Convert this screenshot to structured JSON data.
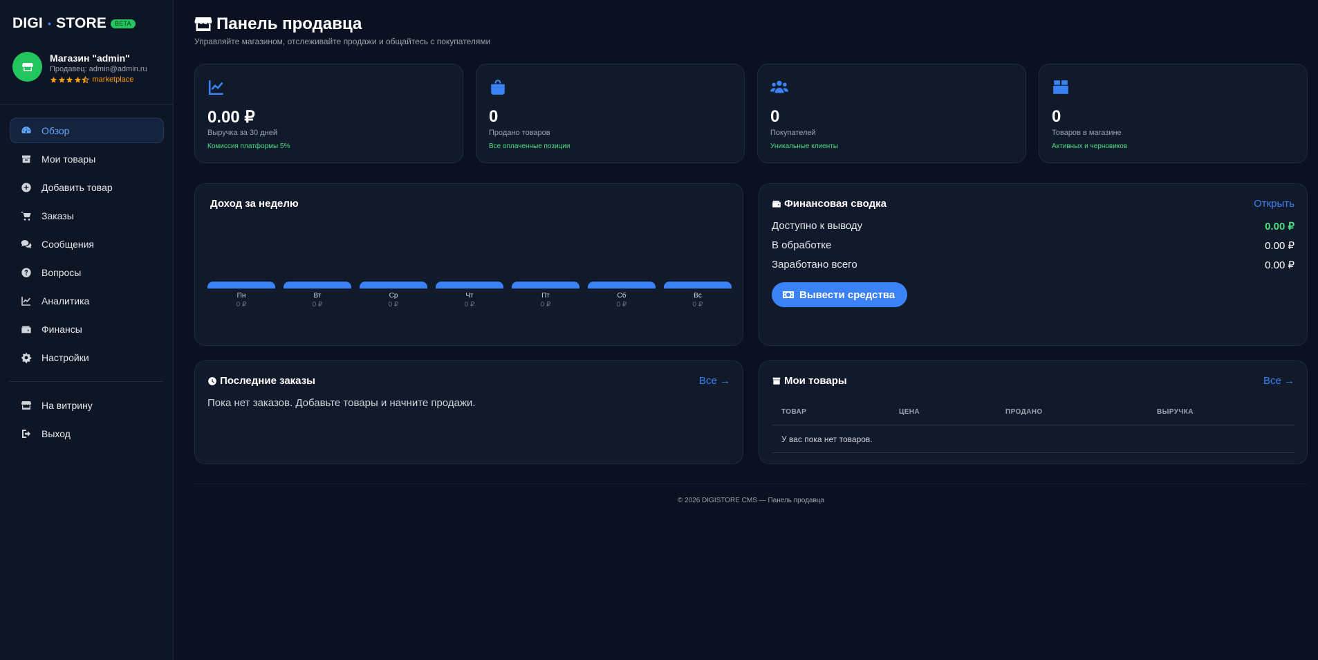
{
  "brand": {
    "part1": "DIGI",
    "dot": "•",
    "part2": "STORE",
    "badge": "BETA"
  },
  "profile": {
    "store_name": "Магазин \"admin\"",
    "seller": "Продавец: admin@admin.ru",
    "rating_label": "marketplace",
    "stars": 4.5
  },
  "nav": {
    "items": [
      {
        "label": "Обзор",
        "icon": "gauge-icon",
        "active": true
      },
      {
        "label": "Мои товары",
        "icon": "box-icon"
      },
      {
        "label": "Добавить товар",
        "icon": "plus-circle-icon"
      },
      {
        "label": "Заказы",
        "icon": "cart-icon"
      },
      {
        "label": "Сообщения",
        "icon": "comments-icon"
      },
      {
        "label": "Вопросы",
        "icon": "question-circle-icon"
      },
      {
        "label": "Аналитика",
        "icon": "chart-line-icon"
      },
      {
        "label": "Финансы",
        "icon": "wallet-icon"
      },
      {
        "label": "Настройки",
        "icon": "gear-icon"
      }
    ],
    "bottom": [
      {
        "label": "На витрину",
        "icon": "store-icon"
      },
      {
        "label": "Выход",
        "icon": "logout-icon"
      }
    ]
  },
  "header": {
    "title": "Панель продавца",
    "subtitle": "Управляйте магазином, отслеживайте продажи и общайтесь с покупателями"
  },
  "stats": [
    {
      "value": "0.00 ₽",
      "label": "Выручка за 30 дней",
      "note": "Комиссия платформы 5%",
      "icon": "chart-line-icon"
    },
    {
      "value": "0",
      "label": "Продано товаров",
      "note": "Все оплаченные позиции",
      "icon": "shopping-bag-icon"
    },
    {
      "value": "0",
      "label": "Покупателей",
      "note": "Уникальные клиенты",
      "icon": "users-icon"
    },
    {
      "value": "0",
      "label": "Товаров в магазине",
      "note": "Активных и черновиков",
      "icon": "box-icon"
    }
  ],
  "weekly": {
    "title": "Доход за неделю",
    "days": [
      {
        "day": "Пн",
        "value": "0 ₽"
      },
      {
        "day": "Вт",
        "value": "0 ₽"
      },
      {
        "day": "Ср",
        "value": "0 ₽"
      },
      {
        "day": "Чт",
        "value": "0 ₽"
      },
      {
        "day": "Пт",
        "value": "0 ₽"
      },
      {
        "day": "Сб",
        "value": "0 ₽"
      },
      {
        "day": "Вс",
        "value": "0 ₽"
      }
    ]
  },
  "chart_data": {
    "type": "bar",
    "title": "Доход за неделю",
    "categories": [
      "Пн",
      "Вт",
      "Ср",
      "Чт",
      "Пт",
      "Сб",
      "Вс"
    ],
    "values": [
      0,
      0,
      0,
      0,
      0,
      0,
      0
    ]
  },
  "finance": {
    "title": "Финансовая сводка",
    "open_link": "Открыть",
    "rows": [
      {
        "label": "Доступно к выводу",
        "value": "0.00 ₽"
      },
      {
        "label": "В обработке",
        "value": "0.00 ₽"
      },
      {
        "label": "Заработано всего",
        "value": "0.00 ₽"
      }
    ],
    "withdraw": "Вывести средства"
  },
  "orders": {
    "title": "Последние заказы",
    "link": "Все →",
    "empty": "Пока нет заказов. Добавьте товары и начните продажи."
  },
  "products": {
    "title": "Мои товары",
    "link": "Все →",
    "columns": [
      "ТОВАР",
      "ЦЕНА",
      "ПРОДАНО",
      "ВЫРУЧКА"
    ],
    "empty": "У вас пока нет товаров."
  },
  "footer": "© 2026 DIGISTORE CMS — Панель продавца",
  "colors": {
    "accent": "#3b82f6",
    "success": "#4ade80",
    "background": "#0b1120",
    "card": "#111a2b"
  }
}
